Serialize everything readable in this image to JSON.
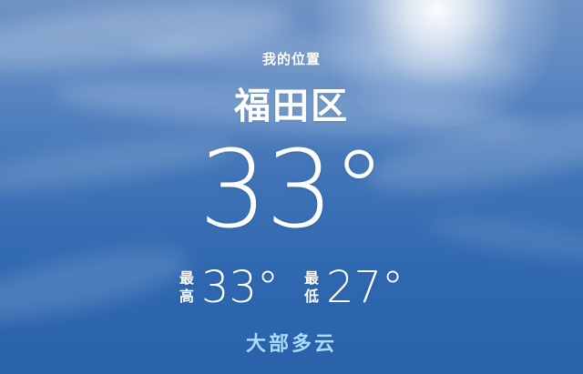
{
  "location": {
    "label": "我的位置",
    "city": "福田区"
  },
  "temperature": {
    "current": "33°"
  },
  "high": {
    "label_char_1": "最",
    "label_char_2": "高",
    "value": "33°"
  },
  "low": {
    "label_char_1": "最",
    "label_char_2": "低",
    "value": "27°"
  },
  "condition": "大部多云",
  "colors": {
    "condition_text": "#a8ddff",
    "sky_top": "#6f93c4",
    "sky_bottom": "#2a62ab"
  }
}
